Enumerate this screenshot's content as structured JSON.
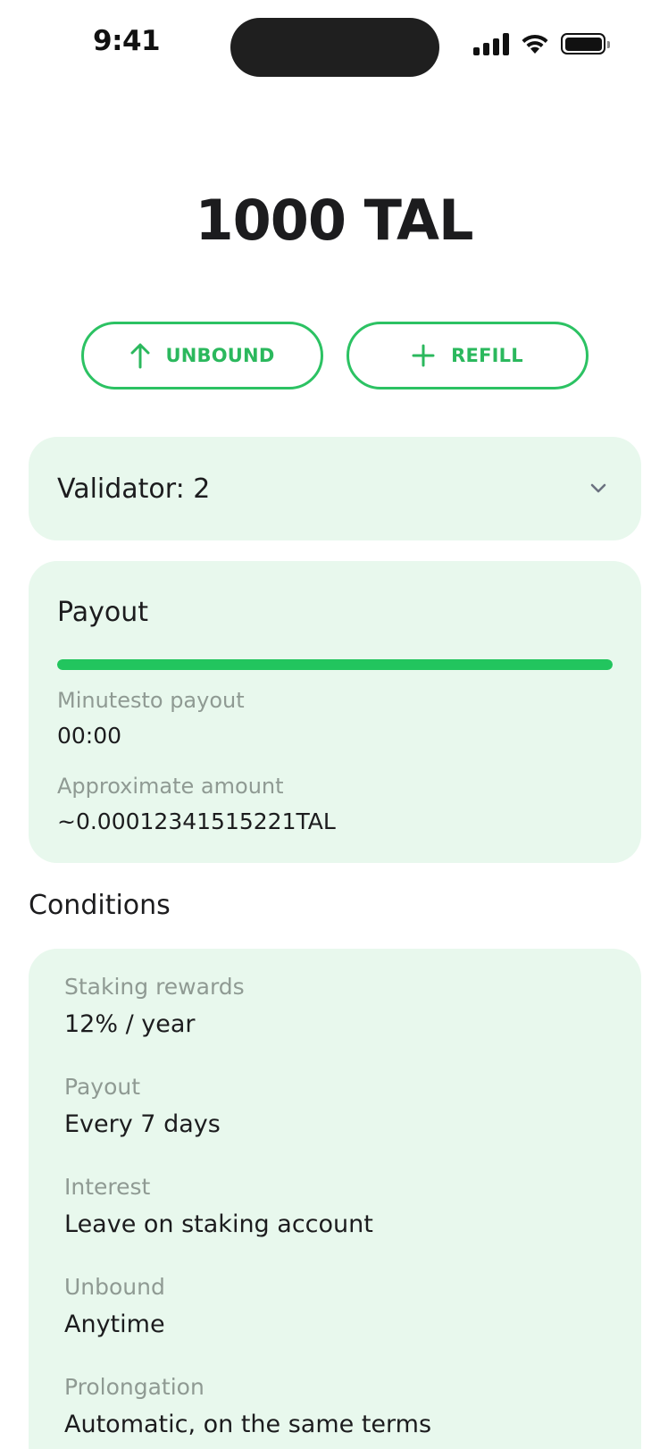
{
  "status": {
    "time": "9:41"
  },
  "balance": "1000 TAL",
  "actions": {
    "unbound_label": "UNBOUND",
    "refill_label": "REFILL"
  },
  "validator": {
    "label": "Validator: 2"
  },
  "payout": {
    "title": "Payout",
    "progress": 1.0,
    "minutes_label": "Minutesto payout",
    "minutes_value": "00:00",
    "amount_label": "Approximate amount",
    "amount_value": "~0.00012341515221TAL"
  },
  "conditions": {
    "title": "Conditions",
    "items": [
      {
        "label": "Staking rewards",
        "value": "12% / year"
      },
      {
        "label": "Payout",
        "value": "Every 7 days"
      },
      {
        "label": "Interest",
        "value": "Leave on staking account"
      },
      {
        "label": "Unbound",
        "value": "Anytime"
      },
      {
        "label": "Prolongation",
        "value": "Automatic, on the same terms"
      }
    ]
  },
  "colors": {
    "accent": "#22c55e",
    "card_bg": "#e8f8ed",
    "muted_text": "#8f9a93"
  }
}
